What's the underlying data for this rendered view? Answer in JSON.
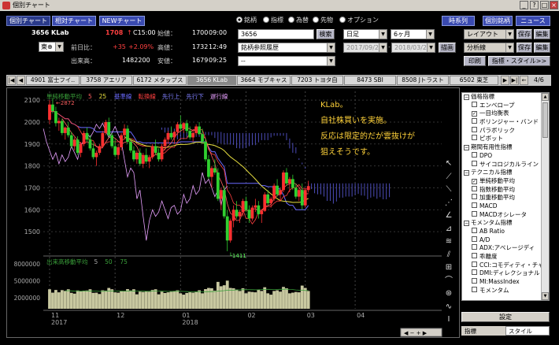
{
  "window": {
    "title": "個別チャート"
  },
  "top_buttons": [
    "個別チャート",
    "相対チャート",
    "NEWチャート"
  ],
  "stock": {
    "code_name": "3656 KLab",
    "price": "1708",
    "arrow": "↑",
    "time": "C15:00",
    "open_label": "始値：",
    "open": "1700",
    "open_time": "09:00",
    "change_label": "前日比：",
    "change": "+35",
    "change_pct": "+2.09%",
    "high_label": "高値：",
    "high": "1732",
    "high_time": "12:49",
    "exchange": "東⊕",
    "volume_label": "出来高：",
    "volume": "1482200",
    "low_label": "安値：",
    "low": "1679",
    "low_time": "09:25"
  },
  "radios": [
    {
      "label": "銘柄",
      "checked": true
    },
    {
      "label": "指標",
      "checked": false
    },
    {
      "label": "為替",
      "checked": false
    },
    {
      "label": "先物",
      "checked": false
    },
    {
      "label": "オプション",
      "checked": false
    }
  ],
  "search": {
    "value": "3656",
    "button": "検索",
    "history": "銘柄参照履歴",
    "blank": "--"
  },
  "period": {
    "unit": "日足",
    "span": "6ヶ月",
    "from": "2017/09/29",
    "to": "2018/03/29",
    "draw": "描画"
  },
  "right_buttons": {
    "timeseries": "時系列",
    "individual": "個別銘柄",
    "news": "ニュース",
    "layout": "レイアウト",
    "save": "保存",
    "edit": "編集",
    "analysis": "分析線",
    "save2": "保存",
    "edit2": "編集",
    "print": "印刷",
    "indicator_style": "指標・スタイル>>"
  },
  "tabs": [
    "4901 富士フイ..",
    "3758 アエリア",
    "6172 メタップス",
    "3656 KLab",
    "3664 モブキャス",
    "7203 トヨタ自",
    "8473 SBI",
    "8508 Jトラスト",
    "6502 東芝"
  ],
  "tab_active": "3656 KLab",
  "page_indicator": "4/6",
  "legend_main": [
    {
      "text": "単純移動平均",
      "color": "#3aa03a"
    },
    {
      "text": "5",
      "color": "#ff6060"
    },
    {
      "text": "25",
      "color": "#e8e040"
    },
    {
      "text": "基準線",
      "color": "#6a6aff"
    },
    {
      "text": "転換線",
      "color": "#ff4040"
    },
    {
      "text": "先行上",
      "color": "#8080ff"
    },
    {
      "text": "先行下",
      "color": "#8080ff"
    },
    {
      "text": "遅行線",
      "color": "#e8a0ff"
    }
  ],
  "legend_volume": [
    {
      "text": "出来高移動平均",
      "color": "#3aa03a"
    },
    {
      "text": "5",
      "color": "#aaaaaa"
    },
    {
      "text": "50",
      "color": "#3aa03a"
    },
    {
      "text": "75",
      "color": "#3aa03a"
    }
  ],
  "annotation": [
    "KLab。",
    "自社株買いを実施。",
    "反応は限定的だが雲抜けが",
    "狙えそうです。"
  ],
  "annotation_color": "#ffd23a",
  "price_high_label": "2872",
  "price_low_label": "1411",
  "chart_data": {
    "type": "candlestick",
    "y_ticks": [
      1500,
      1600,
      1700,
      1800,
      1900,
      2000,
      2100
    ],
    "ylim": [
      1400,
      2140
    ],
    "volume_ticks": [
      "8000000",
      "5000000",
      "2000000"
    ],
    "volume_ylim": [
      0,
      9000000
    ],
    "x_ticks": [
      "11",
      "12",
      "01",
      "02",
      "03",
      "04"
    ],
    "year_labels": [
      "2017",
      "2018"
    ],
    "candles": [
      [
        2010,
        2100,
        1990,
        2080
      ],
      [
        2080,
        2110,
        2040,
        2050
      ],
      [
        2050,
        2070,
        1980,
        1995
      ],
      [
        1995,
        2020,
        1960,
        2005
      ],
      [
        2005,
        2015,
        1940,
        1950
      ],
      [
        1950,
        1980,
        1920,
        1975
      ],
      [
        1975,
        2000,
        1930,
        1940
      ],
      [
        1940,
        1955,
        1880,
        1890
      ],
      [
        1890,
        1930,
        1870,
        1920
      ],
      [
        1920,
        1935,
        1850,
        1860
      ],
      [
        1860,
        1910,
        1840,
        1900
      ],
      [
        1900,
        1960,
        1890,
        1950
      ],
      [
        1950,
        1975,
        1910,
        1920
      ],
      [
        1920,
        1940,
        1870,
        1880
      ],
      [
        1880,
        1905,
        1830,
        1840
      ],
      [
        1840,
        1870,
        1800,
        1860
      ],
      [
        1860,
        1900,
        1850,
        1890
      ],
      [
        1890,
        1960,
        1880,
        1950
      ],
      [
        1950,
        2010,
        1940,
        2000
      ],
      [
        2000,
        2020,
        1930,
        1940
      ],
      [
        1940,
        1950,
        1880,
        1890
      ],
      [
        1890,
        1920,
        1840,
        1850
      ],
      [
        1850,
        1900,
        1830,
        1885
      ],
      [
        1885,
        1950,
        1870,
        1940
      ],
      [
        1940,
        1990,
        1920,
        1970
      ],
      [
        1970,
        1985,
        1900,
        1910
      ],
      [
        1910,
        1925,
        1860,
        1870
      ],
      [
        1870,
        1890,
        1820,
        1830
      ],
      [
        1830,
        1870,
        1810,
        1860
      ],
      [
        1860,
        1880,
        1800,
        1810
      ],
      [
        1810,
        1860,
        1790,
        1850
      ],
      [
        1850,
        1880,
        1810,
        1820
      ],
      [
        1820,
        1850,
        1790,
        1840
      ],
      [
        1840,
        1900,
        1830,
        1890
      ],
      [
        1890,
        1920,
        1850,
        1860
      ],
      [
        1860,
        1880,
        1820,
        1830
      ],
      [
        1830,
        1900,
        1820,
        1890
      ],
      [
        1890,
        1930,
        1870,
        1920
      ],
      [
        1920,
        1960,
        1900,
        1950
      ],
      [
        1950,
        1980,
        1920,
        1930
      ],
      [
        1930,
        1960,
        1900,
        1955
      ],
      [
        1955,
        2000,
        1940,
        1990
      ],
      [
        1990,
        2030,
        1960,
        1970
      ],
      [
        1970,
        2000,
        1950,
        1995
      ],
      [
        1995,
        2010,
        1950,
        1960
      ],
      [
        1960,
        1980,
        1920,
        1930
      ],
      [
        1930,
        1960,
        1910,
        1950
      ],
      [
        1950,
        1990,
        1940,
        1980
      ],
      [
        1980,
        2000,
        1940,
        1945
      ],
      [
        1945,
        1970,
        1900,
        1910
      ],
      [
        1910,
        1925,
        1820,
        1830
      ],
      [
        1830,
        1850,
        1740,
        1750
      ],
      [
        1750,
        1800,
        1700,
        1790
      ],
      [
        1790,
        1830,
        1760,
        1770
      ],
      [
        1770,
        1790,
        1640,
        1650
      ],
      [
        1650,
        1700,
        1600,
        1690
      ],
      [
        1690,
        1710,
        1560,
        1570
      ],
      [
        1570,
        1600,
        1411,
        1460
      ],
      [
        1460,
        1560,
        1450,
        1550
      ],
      [
        1550,
        1620,
        1520,
        1600
      ],
      [
        1600,
        1640,
        1560,
        1570
      ],
      [
        1570,
        1600,
        1540,
        1590
      ],
      [
        1590,
        1650,
        1570,
        1640
      ],
      [
        1640,
        1660,
        1590,
        1600
      ],
      [
        1600,
        1620,
        1540,
        1560
      ],
      [
        1560,
        1620,
        1550,
        1610
      ],
      [
        1610,
        1650,
        1590,
        1620
      ],
      [
        1620,
        1640,
        1560,
        1580
      ],
      [
        1580,
        1600,
        1540,
        1595
      ],
      [
        1595,
        1680,
        1590,
        1670
      ],
      [
        1670,
        1690,
        1620,
        1630
      ],
      [
        1630,
        1660,
        1610,
        1650
      ],
      [
        1650,
        1720,
        1640,
        1710
      ],
      [
        1710,
        1740,
        1660,
        1670
      ],
      [
        1670,
        1700,
        1640,
        1690
      ],
      [
        1690,
        1780,
        1680,
        1770
      ],
      [
        1770,
        1790,
        1710,
        1720
      ],
      [
        1720,
        1750,
        1680,
        1740
      ],
      [
        1740,
        1760,
        1690,
        1700
      ],
      [
        1700,
        1720,
        1650,
        1660
      ],
      [
        1660,
        1700,
        1640,
        1690
      ],
      [
        1690,
        1720,
        1600,
        1620
      ],
      [
        1620,
        1700,
        1610,
        1690
      ],
      [
        1690,
        1732,
        1679,
        1708
      ]
    ]
  },
  "indicator_tree": [
    {
      "text": "価格指標",
      "level": 0,
      "type": "group"
    },
    {
      "text": "エンベロープ",
      "level": 1,
      "type": "check",
      "checked": false
    },
    {
      "text": "一目均衡表",
      "level": 1,
      "type": "check",
      "checked": true
    },
    {
      "text": "ボリンジャー・バンド",
      "level": 1,
      "type": "check",
      "checked": false
    },
    {
      "text": "パラボリック",
      "level": 1,
      "type": "check",
      "checked": false
    },
    {
      "text": "ピボット",
      "level": 1,
      "type": "check",
      "checked": false
    },
    {
      "text": "期間有用性指標",
      "level": 0,
      "type": "group"
    },
    {
      "text": "DPO",
      "level": 1,
      "type": "check",
      "checked": false
    },
    {
      "text": "サイコロジカルライン",
      "level": 1,
      "type": "check",
      "checked": false
    },
    {
      "text": "テクニカル指標",
      "level": 0,
      "type": "group"
    },
    {
      "text": "単純移動平均",
      "level": 1,
      "type": "check",
      "checked": true
    },
    {
      "text": "指数移動平均",
      "level": 1,
      "type": "check",
      "checked": false
    },
    {
      "text": "加重移動平均",
      "level": 1,
      "type": "check",
      "checked": false
    },
    {
      "text": "MACD",
      "level": 1,
      "type": "check",
      "checked": false
    },
    {
      "text": "MACDオシレータ",
      "level": 1,
      "type": "check",
      "checked": false
    },
    {
      "text": "モメンタム指標",
      "level": 0,
      "type": "group"
    },
    {
      "text": "AB Ratio",
      "level": 1,
      "type": "check",
      "checked": false
    },
    {
      "text": "A/D",
      "level": 1,
      "type": "check",
      "checked": false
    },
    {
      "text": "ADX:アベレージディ",
      "level": 1,
      "type": "check",
      "checked": false
    },
    {
      "text": "乖離度",
      "level": 1,
      "type": "check",
      "checked": false
    },
    {
      "text": "CCI:コモディティ・チャ",
      "level": 1,
      "type": "check",
      "checked": false
    },
    {
      "text": "DMI:ディレクショナル",
      "level": 1,
      "type": "check",
      "checked": false
    },
    {
      "text": "MI:MassIndex",
      "level": 1,
      "type": "check",
      "checked": false
    },
    {
      "text": "モメンタム",
      "level": 1,
      "type": "check",
      "checked": false
    }
  ],
  "panel_button": "設定",
  "panel_tabs": [
    "指標",
    "スタイル"
  ]
}
